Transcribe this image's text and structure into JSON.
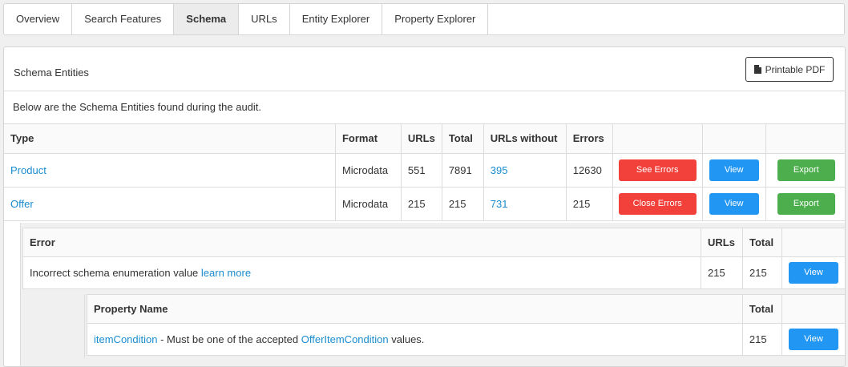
{
  "tabs": [
    {
      "label": "Overview"
    },
    {
      "label": "Search Features"
    },
    {
      "label": "Schema",
      "active": true
    },
    {
      "label": "URLs"
    },
    {
      "label": "Entity Explorer"
    },
    {
      "label": "Property Explorer"
    }
  ],
  "panel": {
    "title": "Schema Entities",
    "pdf_button": "Printable PDF",
    "intro": "Below are the Schema Entities found during the audit."
  },
  "main_table": {
    "headers": [
      "Type",
      "Format",
      "URLs",
      "Total",
      "URLs without",
      "Errors"
    ],
    "rows": [
      {
        "type": "Product",
        "format": "Microdata",
        "urls": "551",
        "total": "7891",
        "without": "395",
        "errors": "12630",
        "errors_button": "See Errors",
        "view": "View",
        "export": "Export"
      },
      {
        "type": "Offer",
        "format": "Microdata",
        "urls": "215",
        "total": "215",
        "without": "731",
        "errors": "215",
        "errors_button": "Close Errors",
        "view": "View",
        "export": "Export"
      }
    ]
  },
  "errors_table": {
    "headers": [
      "Error",
      "URLs",
      "Total"
    ],
    "row": {
      "text": "Incorrect schema enumeration value",
      "link": "learn more",
      "urls": "215",
      "total": "215",
      "view": "View"
    }
  },
  "property_table": {
    "headers": [
      "Property Name",
      "Total"
    ],
    "row": {
      "property": "itemCondition",
      "mid": " - Must be one of the accepted ",
      "link": "OfferItemCondition",
      "tail": " values.",
      "total": "215",
      "view": "View"
    }
  },
  "colors": {
    "link": "#1a8ccf",
    "danger": "#f2403b",
    "primary": "#2196f3",
    "success": "#4cae4c"
  },
  "icons": {
    "pdf": "file-icon"
  }
}
